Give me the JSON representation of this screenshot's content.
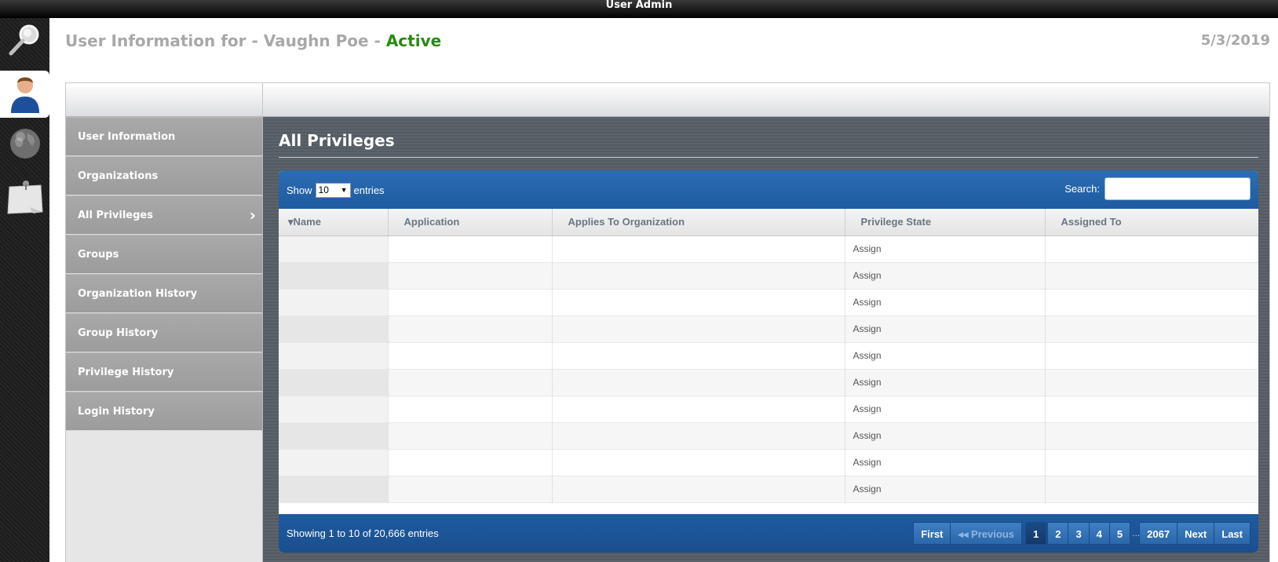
{
  "window": {
    "title": "User Admin"
  },
  "rail": {
    "items": [
      {
        "icon": "magnifier-icon",
        "active": false
      },
      {
        "icon": "user-icon",
        "active": true
      },
      {
        "icon": "globe-icon",
        "active": false
      },
      {
        "icon": "notepad-icon",
        "active": false
      }
    ]
  },
  "header": {
    "title_prefix": "User Information for - Vaughn Poe - ",
    "status": "Active",
    "date": "5/3/2019",
    "status_color": "#2a8a12"
  },
  "sidebar": {
    "items": [
      {
        "label": "User Information"
      },
      {
        "label": "Organizations"
      },
      {
        "label": "All Privileges",
        "selected": true
      },
      {
        "label": "Groups"
      },
      {
        "label": "Organization History"
      },
      {
        "label": "Group History"
      },
      {
        "label": "Privilege History"
      },
      {
        "label": "Login History"
      }
    ]
  },
  "main": {
    "title": "All Privileges",
    "show_label": "Show",
    "page_size": "10",
    "entries_label": "entries",
    "search_label": "Search:",
    "search_value": "",
    "columns": [
      "Name",
      "Application",
      "Applies To Organization",
      "Privilege State",
      "Assigned To"
    ],
    "rows": [
      [
        "",
        "",
        "",
        "Assign",
        ""
      ],
      [
        "",
        "",
        "",
        "Assign",
        ""
      ],
      [
        "",
        "",
        "",
        "Assign",
        ""
      ],
      [
        "",
        "",
        "",
        "Assign",
        ""
      ],
      [
        "",
        "",
        "",
        "Assign",
        ""
      ],
      [
        "",
        "",
        "",
        "Assign",
        ""
      ],
      [
        "",
        "",
        "",
        "Assign",
        ""
      ],
      [
        "",
        "",
        "",
        "Assign",
        ""
      ],
      [
        "",
        "",
        "",
        "Assign",
        ""
      ],
      [
        "",
        "",
        "",
        "Assign",
        ""
      ]
    ],
    "info": "Showing 1 to 10 of 20,666 entries",
    "pager": {
      "first": "First",
      "previous": "Previous",
      "pages": [
        "1",
        "2",
        "3",
        "4",
        "5"
      ],
      "ellipsis": "...",
      "last_page": "2067",
      "next": "Next",
      "last": "Last"
    },
    "colors": {
      "toolbar_blue": "#2c6db3",
      "footer_blue": "#1e5ba1"
    }
  }
}
